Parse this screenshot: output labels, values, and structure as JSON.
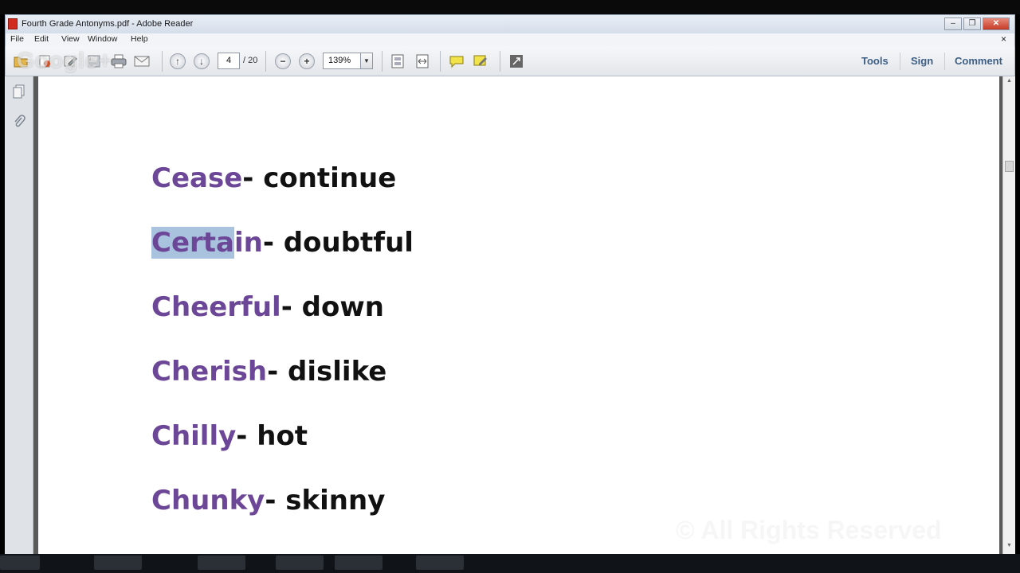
{
  "window": {
    "title": "Fourth Grade Antonyms.pdf - Adobe Reader",
    "controls": {
      "minimize": "–",
      "restore": "❐",
      "close": "✕"
    }
  },
  "overlay": {
    "logo_text": "Google+"
  },
  "menu": {
    "items": [
      "File",
      "Edit",
      "View",
      "Window",
      "Help"
    ],
    "close_glyph": "×"
  },
  "toolbar": {
    "page_current": "4",
    "page_total": "/ 20",
    "zoom": "139%",
    "zoom_arrow": "▼",
    "links": {
      "tools": "Tools",
      "sign": "Sign",
      "comment": "Comment"
    }
  },
  "document": {
    "entries": [
      {
        "word": "Cease",
        "antonym": "- continue"
      },
      {
        "word_selected": "Certa",
        "word_rest": "in",
        "antonym": "- doubtful"
      },
      {
        "word": "Cheerful",
        "antonym": "- down"
      },
      {
        "word": "Cherish",
        "antonym": "- dislike"
      },
      {
        "word": "Chilly",
        "antonym": "- hot"
      },
      {
        "word": "Chunky",
        "antonym": "- skinny"
      }
    ],
    "watermark": "© All Rights Reserved"
  },
  "colors": {
    "word": "#6d4797",
    "antonym": "#111111",
    "selection": "#a9c3df",
    "link": "#3d5f86"
  }
}
